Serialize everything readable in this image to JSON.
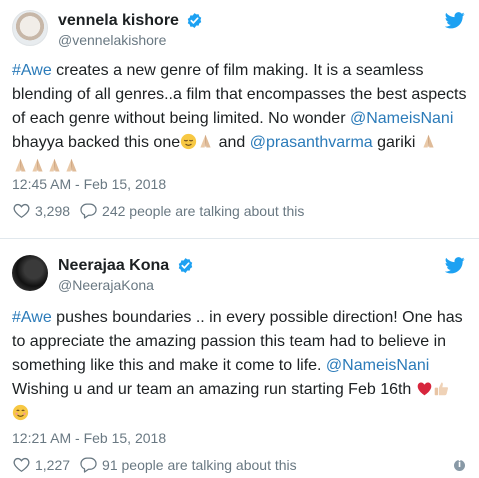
{
  "tweets": [
    {
      "display_name": "vennela kishore",
      "handle": "@vennelakishore",
      "text_parts": [
        {
          "t": "#Awe",
          "k": "ht"
        },
        {
          "t": " creates a new genre of film making. It is a seamless\nblending of all genres..a film that encompasses the best aspects\nof each genre without being limited. No wonder ",
          "k": "txt"
        },
        {
          "t": "@NameisNani",
          "k": "mn"
        },
        {
          "t": "\nbhayya backed this one",
          "k": "txt"
        },
        {
          "t": " and ",
          "k": "txt"
        },
        {
          "t": "@prasanthvarma",
          "k": "mn"
        },
        {
          "t": " gariki ",
          "k": "txt"
        }
      ],
      "timestamp": "12:45 AM - Feb 15, 2018",
      "likes": "3,298",
      "talking": "242 people are talking about this"
    },
    {
      "display_name": "Neerajaa Kona",
      "handle": "@NeerajaKona",
      "text_parts": [
        {
          "t": "#Awe",
          "k": "ht"
        },
        {
          "t": " pushes boundaries .. in every possible direction! One has\nto appreciate the amazing passion this team had to believe in\nsomething like this and make it come to life. ",
          "k": "txt"
        },
        {
          "t": "@NameisNani",
          "k": "mn"
        },
        {
          "t": "\nWishing u and ur team an amazing run starting Feb 16th ",
          "k": "txt"
        }
      ],
      "timestamp": "12:21 AM - Feb 15, 2018",
      "likes": "1,227",
      "talking": "91 people are talking about this"
    }
  ],
  "icons": {
    "verified": "verified-badge-icon",
    "bird": "twitter-bird-icon",
    "heart": "heart-icon",
    "comment": "comment-bubble-icon",
    "info": "info-icon",
    "pray": "folded-hands-emoji",
    "relieved": "relieved-face-emoji",
    "red_heart": "red-heart-emoji",
    "thumbs": "thumbs-up-emoji",
    "smile": "smiling-face-emoji"
  },
  "colors": {
    "link": "#2b7bb9",
    "muted": "#697882",
    "twitter_blue": "#1da1f2"
  }
}
